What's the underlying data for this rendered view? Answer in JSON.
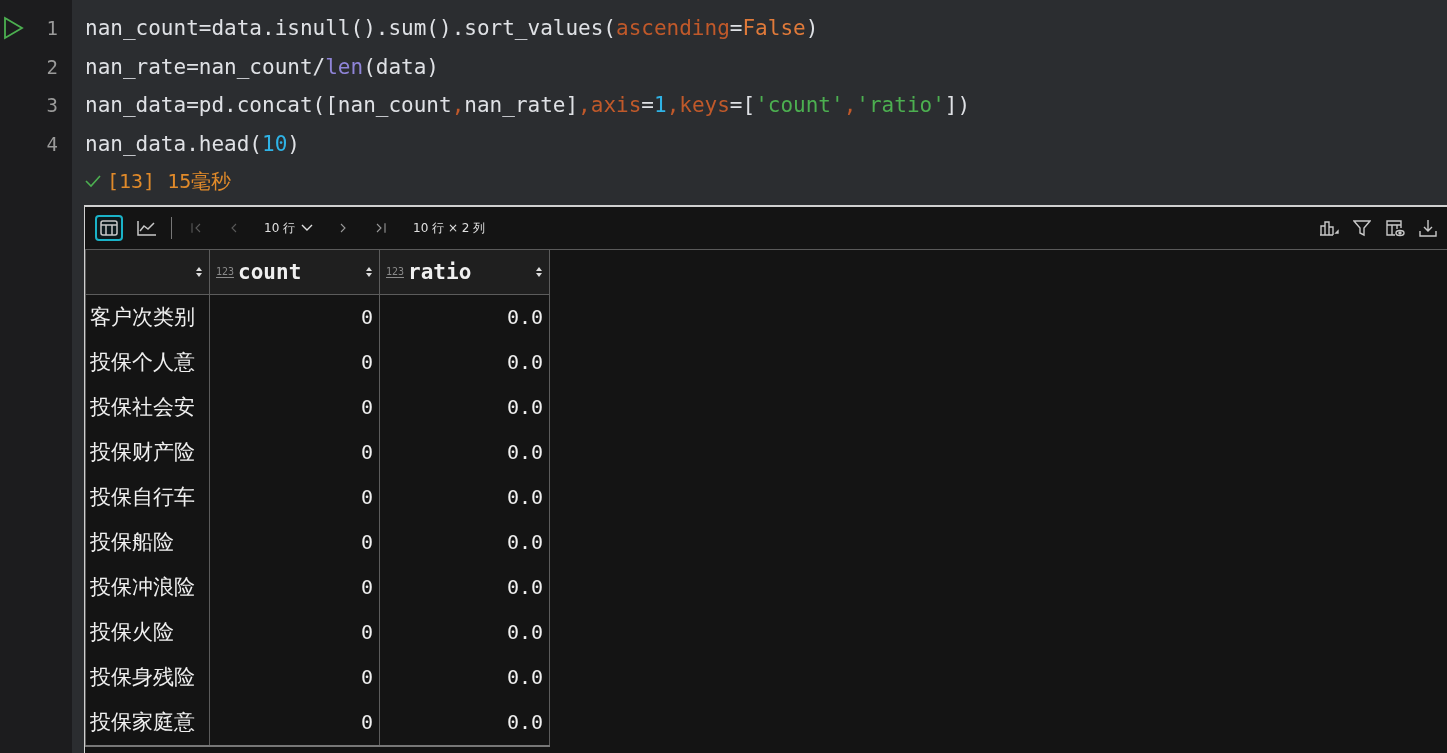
{
  "cell": {
    "lines": [
      {
        "number": "1",
        "tokens": [
          {
            "text": "nan_count=data.isnull().sum().sort_values(",
            "kind": "plain"
          },
          {
            "text": "ascending",
            "kind": "param"
          },
          {
            "text": "=",
            "kind": "plain"
          },
          {
            "text": "False",
            "kind": "constant"
          },
          {
            "text": ")",
            "kind": "plain"
          }
        ]
      },
      {
        "number": "2",
        "tokens": [
          {
            "text": "nan_rate=nan_count/",
            "kind": "plain"
          },
          {
            "text": "len",
            "kind": "builtin"
          },
          {
            "text": "(data)",
            "kind": "plain"
          }
        ]
      },
      {
        "number": "3",
        "tokens": [
          {
            "text": "nan_data=pd.concat([nan_count",
            "kind": "plain"
          },
          {
            "text": ",",
            "kind": "param"
          },
          {
            "text": "nan_rate]",
            "kind": "plain"
          },
          {
            "text": ",axis",
            "kind": "param"
          },
          {
            "text": "=",
            "kind": "plain"
          },
          {
            "text": "1",
            "kind": "number"
          },
          {
            "text": ",keys",
            "kind": "param"
          },
          {
            "text": "=[",
            "kind": "plain"
          },
          {
            "text": "'count'",
            "kind": "string"
          },
          {
            "text": ",",
            "kind": "param"
          },
          {
            "text": "'ratio'",
            "kind": "string"
          },
          {
            "text": "])",
            "kind": "plain"
          }
        ]
      },
      {
        "number": "4",
        "tokens": [
          {
            "text": "nan_data.head(",
            "kind": "plain"
          },
          {
            "text": "10",
            "kind": "number"
          },
          {
            "text": ")",
            "kind": "plain"
          }
        ]
      }
    ],
    "status": {
      "label": "[13] 15毫秒"
    }
  },
  "output": {
    "views": [
      {
        "kind": "table",
        "selected": true
      },
      {
        "kind": "chart",
        "selected": false
      }
    ],
    "nav": [
      {
        "kind": "first",
        "disabled": true
      },
      {
        "kind": "prev",
        "disabled": true
      }
    ],
    "page_size": "10 行",
    "nav_after": [
      {
        "kind": "next",
        "disabled": false
      },
      {
        "kind": "last",
        "disabled": false
      }
    ],
    "shape": "10 行 × 2 列",
    "columns": [
      {
        "type_label": "123",
        "label": "count"
      },
      {
        "type_label": "123",
        "label": "ratio"
      }
    ],
    "rows": [
      {
        "index": "客户次类别",
        "values": [
          "0",
          "0.0"
        ]
      },
      {
        "index": "投保个人意",
        "values": [
          "0",
          "0.0"
        ]
      },
      {
        "index": "投保社会安",
        "values": [
          "0",
          "0.0"
        ]
      },
      {
        "index": "投保财产险",
        "values": [
          "0",
          "0.0"
        ]
      },
      {
        "index": "投保自行车",
        "values": [
          "0",
          "0.0"
        ]
      },
      {
        "index": "投保船险",
        "values": [
          "0",
          "0.0"
        ]
      },
      {
        "index": "投保冲浪险",
        "values": [
          "0",
          "0.0"
        ]
      },
      {
        "index": "投保火险",
        "values": [
          "0",
          "0.0"
        ]
      },
      {
        "index": "投保身残险",
        "values": [
          "0",
          "0.0"
        ]
      },
      {
        "index": "投保家庭意",
        "values": [
          "0",
          "0.0"
        ]
      }
    ]
  }
}
